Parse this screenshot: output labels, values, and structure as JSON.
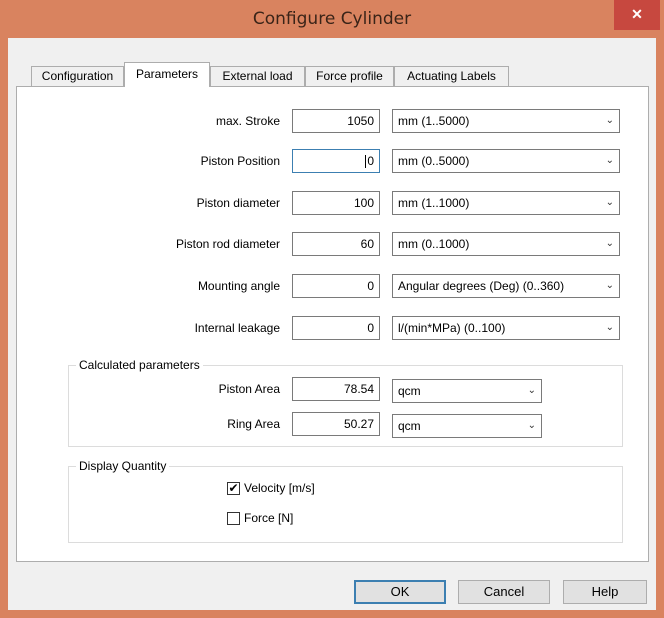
{
  "window": {
    "title": "Configure Cylinder",
    "close_glyph": "✕"
  },
  "tabs": [
    {
      "label": "Configuration",
      "active": false
    },
    {
      "label": "Parameters",
      "active": true
    },
    {
      "label": "External load",
      "active": false
    },
    {
      "label": "Force profile",
      "active": false
    },
    {
      "label": "Actuating Labels",
      "active": false
    }
  ],
  "parameters": [
    {
      "label": "max. Stroke",
      "value": "1050",
      "unit": "mm  (1..5000)"
    },
    {
      "label": "Piston Position",
      "value": "0",
      "unit": "mm  (0..5000)"
    },
    {
      "label": "Piston diameter",
      "value": "100",
      "unit": "mm  (1..1000)"
    },
    {
      "label": "Piston rod diameter",
      "value": "60",
      "unit": "mm  (0..1000)"
    },
    {
      "label": "Mounting angle",
      "value": "0",
      "unit": "Angular degrees (Deg)  (0..360)"
    },
    {
      "label": "Internal leakage",
      "value": "0",
      "unit": "l/(min*MPa)  (0..100)"
    }
  ],
  "calculated": {
    "title": "Calculated parameters",
    "rows": [
      {
        "label": "Piston Area",
        "value": "78.54",
        "unit": "qcm"
      },
      {
        "label": "Ring Area",
        "value": "50.27",
        "unit": "qcm"
      }
    ]
  },
  "display_quantity": {
    "title": "Display Quantity",
    "options": [
      {
        "label": "Velocity [m/s]",
        "checked": true,
        "mark": "✔"
      },
      {
        "label": "Force [N]",
        "checked": false,
        "mark": ""
      }
    ]
  },
  "buttons": {
    "ok": "OK",
    "cancel": "Cancel",
    "help": "Help"
  },
  "icons": {
    "dropdown": "chevron-down-icon",
    "chevron_glyph": "⌄"
  },
  "colors": {
    "titlebar": "#d9835f",
    "close": "#c7483f",
    "focus": "#3c7fb1"
  }
}
